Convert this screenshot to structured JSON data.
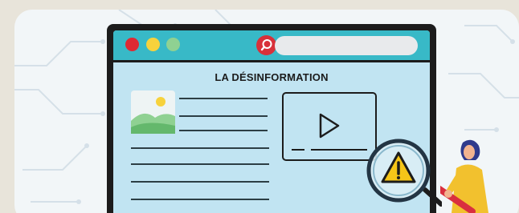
{
  "article": {
    "title": "LA DÉSINFORMATION"
  },
  "colors": {
    "background": "#e8e4da",
    "panel": "#f2f6f8",
    "monitor_frame": "#1c1c1c",
    "screen": "#c1e4f2",
    "topbar": "#38b9c7",
    "dot_red": "#df2a33",
    "dot_yellow": "#f7d23c",
    "dot_green": "#8fd192",
    "search_button": "#d8313a",
    "warning": "#f5c518"
  },
  "icons": {
    "search": "search-icon",
    "image": "image-icon",
    "play": "play-icon",
    "warning": "warning-icon",
    "magnifier": "magnifying-glass-icon"
  }
}
